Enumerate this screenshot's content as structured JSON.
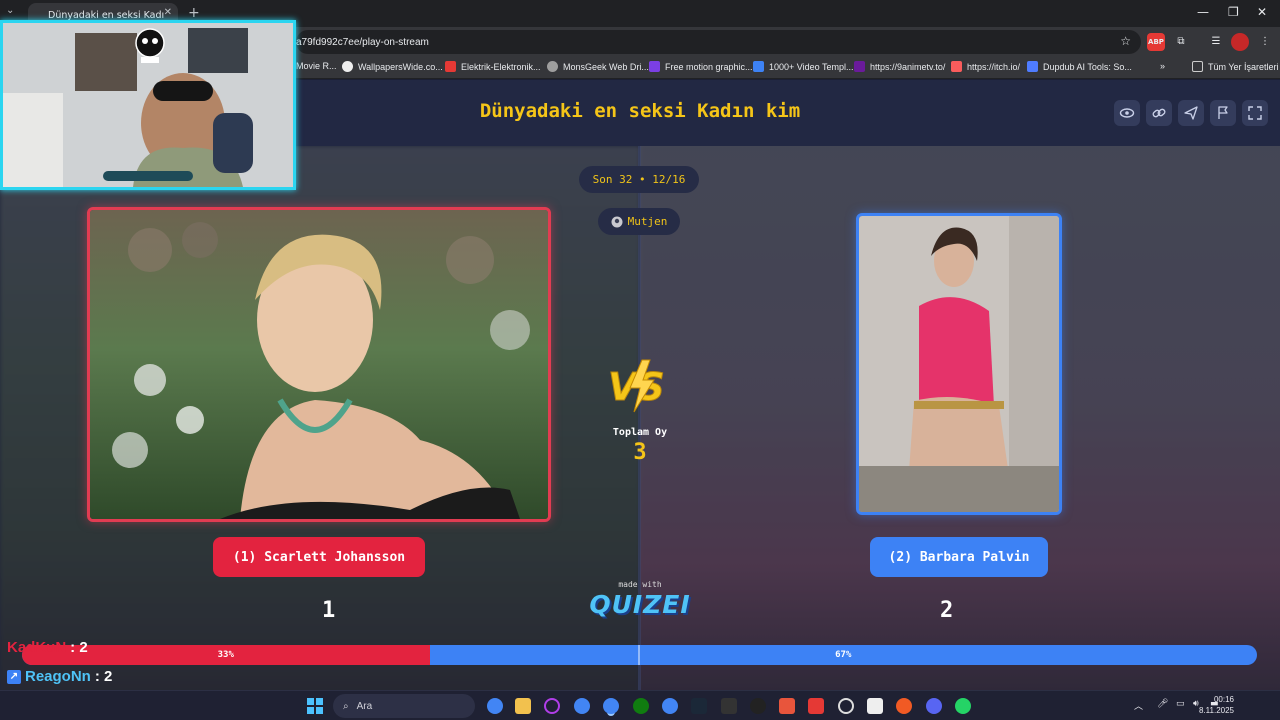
{
  "browser": {
    "tab_title": "Dünyadaki en seksi Kadı",
    "url": "a79fd992c7ee/play-on-stream",
    "bookmarks": [
      "Movie R...",
      "WallpapersWide.co...",
      "Elektrik-Elektronik...",
      "MonsGeek Web Dri...",
      "Free motion graphic...",
      "1000+ Video Templ...",
      "https://9animetv.to/",
      "https://itch.io/",
      "Dupdub AI Tools: So..."
    ],
    "other_bookmarks": "Tüm Yer İşaretleri"
  },
  "quiz": {
    "title": "Dünyadaki en seksi Kadın kim",
    "round": "Son 32 • 12/16",
    "user": "Mutjen",
    "left": {
      "name": "(1) Scarlett Johansson",
      "score": "1",
      "percent": 33
    },
    "right": {
      "name": "(2) Barbara Palvin",
      "score": "2",
      "percent": 67
    },
    "left_percent_label": "33%",
    "right_percent_label": "67%",
    "total_label": "Toplam Oy",
    "total_value": "3",
    "made_with": "made with",
    "brand": "QUIZEI"
  },
  "chat": [
    {
      "user": "KadKuN",
      "count": ": 2"
    },
    {
      "user": "ReagoNn",
      "count": ": 2"
    }
  ],
  "taskbar": {
    "search_placeholder": "Ara",
    "time": "00:16",
    "date": "8.11.2025"
  },
  "colors": {
    "accent_yellow": "#f5c518",
    "left_red": "#e3233f",
    "right_blue": "#3d82f5",
    "webcam_border": "#2bd5f0"
  }
}
